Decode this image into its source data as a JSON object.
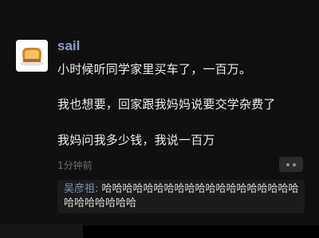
{
  "post": {
    "username": "sail",
    "lines": [
      "小时候听同学家里买车了，一百万。",
      "我也想要，回家跟我妈妈说要交学杂费了",
      "我妈问我多少钱，我说一百万"
    ],
    "timestamp": "1分钟前"
  },
  "more_button": {
    "icon": "more-dots-icon"
  },
  "comment": {
    "author": "吴彦祖:",
    "text": " 哈哈哈哈哈哈哈哈哈哈哈哈哈哈哈哈哈哈哈哈哈哈哈哈哈哈"
  },
  "colors": {
    "name_link": "#8d9fbe",
    "background": "#101010"
  }
}
